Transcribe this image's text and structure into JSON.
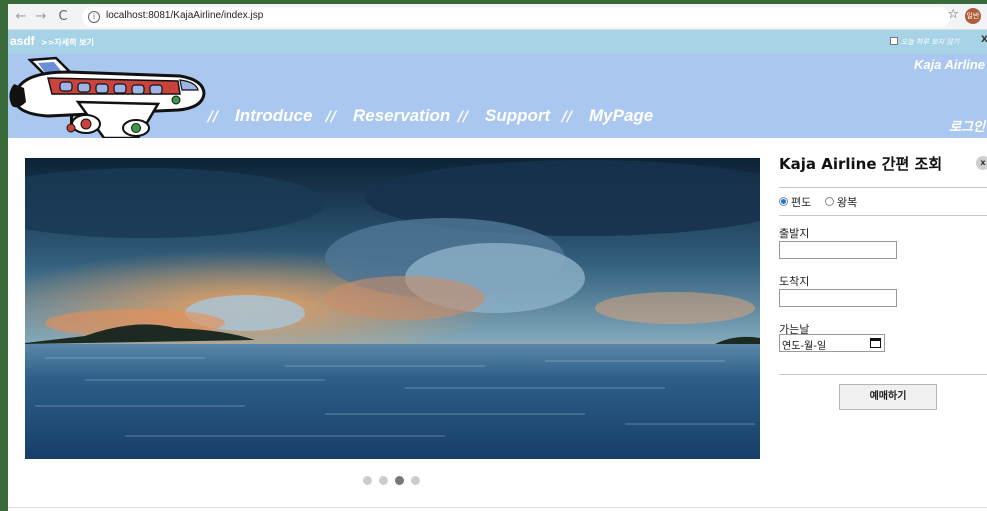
{
  "browser": {
    "url": "localhost:8081/KajaAirline/index.jsp",
    "avatar_label": "일반"
  },
  "notice": {
    "title": "asdf",
    "detail_link": ">>자세히 보기",
    "dont_show_label": "오늘 하루 보지 않기",
    "close_label": "X"
  },
  "header": {
    "brand": "Kaja Airline",
    "login": "로그인",
    "separator": "//",
    "nav": [
      "Introduce",
      "Reservation",
      "Support",
      "MyPage"
    ]
  },
  "carousel": {
    "slide_count": 4,
    "active_index": 2
  },
  "booking": {
    "title": "Kaja Airline 간편 조회",
    "close_label": "x",
    "trip_types": [
      "편도",
      "왕복"
    ],
    "selected_trip": "편도",
    "departure_label": "출발지",
    "departure_value": "",
    "arrival_label": "도착지",
    "arrival_value": "",
    "date_label": "가는날",
    "date_placeholder": "연도-월-일",
    "submit_label": "예매하기"
  },
  "colors": {
    "notice_bg": "#a7d3e6",
    "header_bg": "#a9c7ef",
    "radio_accent": "#1a73e8"
  }
}
